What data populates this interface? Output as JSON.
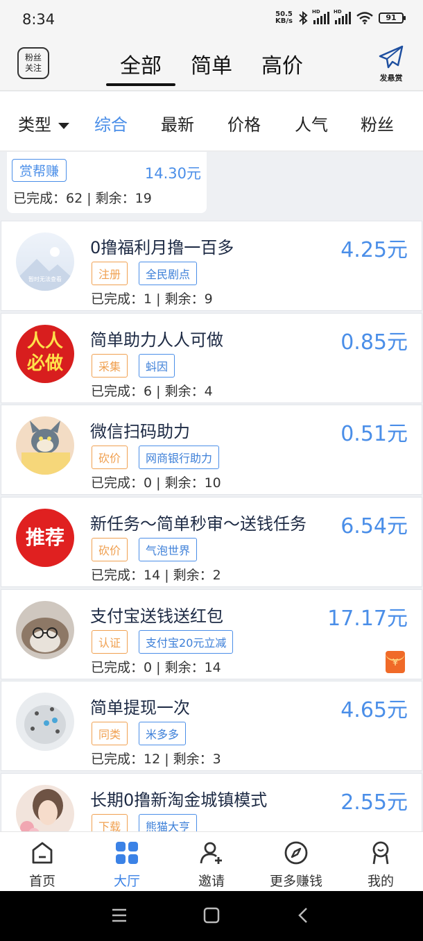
{
  "status": {
    "time": "8:34",
    "net_top": "50.5",
    "net_bottom": "KB/s",
    "sim1": "HD",
    "sim2": "HD",
    "battery": "91"
  },
  "header": {
    "fans_line1": "粉丝",
    "fans_line2": "关注",
    "tabs": [
      "全部",
      "简单",
      "高价"
    ],
    "active_tab": "全部",
    "publish_label": "发悬赏"
  },
  "filters": {
    "type_label": "类型",
    "items": [
      "综合",
      "最新",
      "价格",
      "人气",
      "粉丝"
    ],
    "active": "综合"
  },
  "partial_card": {
    "tag": "赏帮赚",
    "price": "14.30元",
    "stats": "已完成：62 | 剩余：19"
  },
  "tasks": [
    {
      "title": "0撸福利月撸一百多",
      "price": "4.25元",
      "tag1": "注册",
      "tag2": "全民剧点",
      "stats": "已完成：1 | 剩余：9",
      "avatar_text": "暂时无法查看"
    },
    {
      "title": "简单助力人人可做",
      "price": "0.85元",
      "tag1": "采集",
      "tag2": "蚪因",
      "stats": "已完成：6 | 剩余：4",
      "avatar_text1": "人人",
      "avatar_text2": "必做"
    },
    {
      "title": "微信扫码助力",
      "price": "0.51元",
      "tag1": "砍价",
      "tag2": "网商银行助力",
      "stats": "已完成：0 | 剩余：10"
    },
    {
      "title": "新任务～简单秒审～送钱任务",
      "price": "6.54元",
      "tag1": "砍价",
      "tag2": "气泡世界",
      "stats": "已完成：14 | 剩余：2",
      "avatar_text": "推荐"
    },
    {
      "title": "支付宝送钱送红包",
      "price": "17.17元",
      "tag1": "认证",
      "tag2": "支付宝20元立减",
      "stats": "已完成：0 | 剩余：14",
      "redpack": "¥"
    },
    {
      "title": "简单提现一次",
      "price": "4.65元",
      "tag1": "同类",
      "tag2": "米多多",
      "stats": "已完成：12 | 剩余：3"
    },
    {
      "title": "长期0撸新淘金城镇模式",
      "price": "2.55元",
      "tag1": "下载",
      "tag2": "熊猫大亨",
      "stats": ""
    }
  ],
  "bottom_nav": [
    {
      "label": "首页",
      "icon": "home-icon"
    },
    {
      "label": "大厅",
      "icon": "hall-grid-icon"
    },
    {
      "label": "邀请",
      "icon": "invite-user-icon"
    },
    {
      "label": "更多赚钱",
      "icon": "compass-icon"
    },
    {
      "label": "我的",
      "icon": "profile-icon"
    }
  ],
  "colors": {
    "accent": "#4a8ee8",
    "orange_tag": "#f0a050",
    "nav_active": "#3b82e6",
    "red_avatar": "#e02020"
  }
}
